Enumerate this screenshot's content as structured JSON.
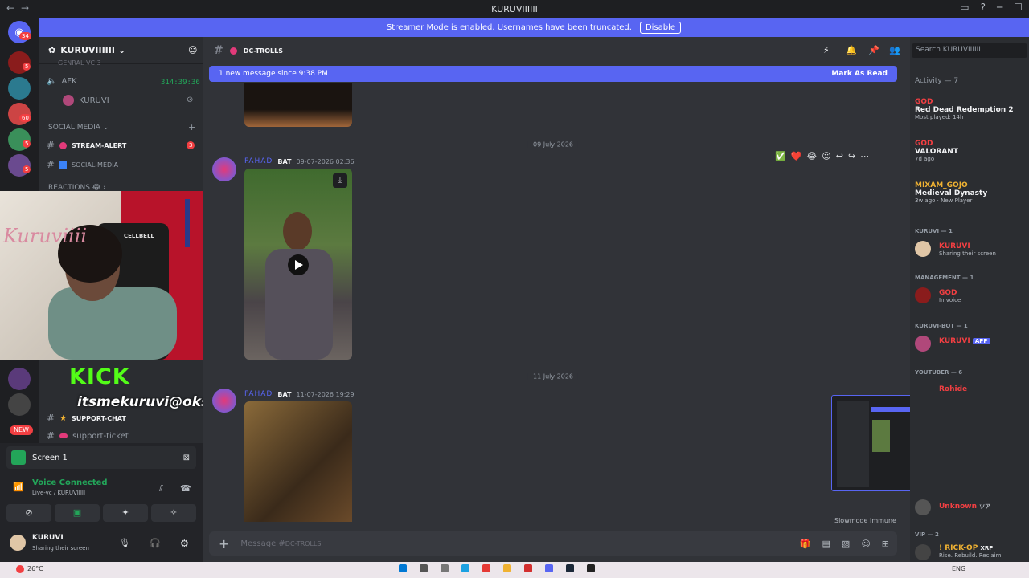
{
  "window": {
    "title": "KURUVIIIIII"
  },
  "streamer_banner": {
    "text": "Streamer Mode is enabled. Usernames have been truncated.",
    "button": "Disable"
  },
  "guild_badges": [
    "34",
    "5",
    "60",
    "5",
    "5",
    "5",
    "NEW"
  ],
  "sidebar": {
    "server_name": "KURUVIIIIII",
    "partial_top": "GENRAL VC 3",
    "voice_afk": {
      "name": "AFK",
      "timer": "314:39:36",
      "member": "KURUVI"
    },
    "category_social": "SOCIAL MEDIA",
    "channels": [
      {
        "name": "STREAM-ALERT",
        "badge": "3"
      },
      {
        "name": "SOCIAL-MEDIA"
      }
    ],
    "category_reactions": "REACTIONS 😂",
    "lower_channels": [
      {
        "name": "SUPPORT-CHAT"
      },
      {
        "name": "support-ticket"
      }
    ]
  },
  "overlay": {
    "kick": "KICK",
    "handle": "itsmekuruvi@oksbi",
    "cellbell": "CELLBELL",
    "wall_text": "Kuruviiii"
  },
  "user_panel": {
    "screen": "Screen 1",
    "voice_status": "Voice Connected",
    "voice_channel": "Live-vc / KURUVIIIII",
    "username": "KURUVI",
    "user_status": "Sharing their screen"
  },
  "channel": {
    "name": "DC-TROLLS"
  },
  "new_message_bar": {
    "text": "1 new message since 9:38 PM",
    "action": "Mark As Read"
  },
  "messages": [
    {
      "date": "09 July 2026",
      "author": "FAHAD",
      "tag": "BAT",
      "timestamp": "09-07-2026 02:36"
    },
    {
      "date": "11 July 2026",
      "author": "FAHAD",
      "tag": "BAT",
      "timestamp": "11-07-2026 19:29"
    }
  ],
  "reactions": [
    "✅",
    "❤️",
    "😂"
  ],
  "slowmode": "Slowmode Immune",
  "composer": {
    "placeholder": "Message #",
    "channel": "DC-TROLLS"
  },
  "members_panel": {
    "search": "Search KURUVIIIIII",
    "activity_header": "Activity — 7",
    "activities": [
      {
        "user": "GOD",
        "game": "Red Dead Redemption 2",
        "detail": "Most played: 14h"
      },
      {
        "user": "GOD",
        "game": "VALORANT",
        "detail": "7d ago"
      },
      {
        "user": "MIXAM_GOJO",
        "game": "Medieval Dynasty",
        "detail": "3w ago",
        "extra": "New Player"
      }
    ],
    "groups": [
      {
        "header": "KURUVI — 1",
        "members": [
          {
            "name": "KURUVI",
            "status": "Sharing their screen",
            "color": "#f23f42"
          }
        ]
      },
      {
        "header": "MANAGEMENT — 1",
        "members": [
          {
            "name": "GOD",
            "status": "In voice",
            "color": "#f23f42"
          }
        ]
      },
      {
        "header": "KURUVI-BOT — 1",
        "members": [
          {
            "name": "KURUVI",
            "status": "",
            "tag": "APP",
            "color": "#f23f42"
          }
        ]
      },
      {
        "header": "YOUTUBER — 6",
        "members": [
          {
            "name": "Rohide",
            "status": "",
            "color": "#f23f42"
          }
        ]
      },
      {
        "header": "",
        "members": [
          {
            "name": "Unknown",
            "status": "",
            "tag": "ツア",
            "color": "#f23f42"
          }
        ]
      },
      {
        "header": "VIP — 2",
        "members": [
          {
            "name": "! RICK-OP",
            "status": "Rise. Rebuild. Reclaim.",
            "tag": "XRP",
            "color": "#f0b232"
          }
        ]
      }
    ]
  },
  "taskbar": {
    "weather": "26°C",
    "lang": "ENG"
  },
  "colors": {
    "blurple": "#5865f2",
    "green": "#23a559",
    "red": "#f23f42",
    "bg": "#313338"
  }
}
